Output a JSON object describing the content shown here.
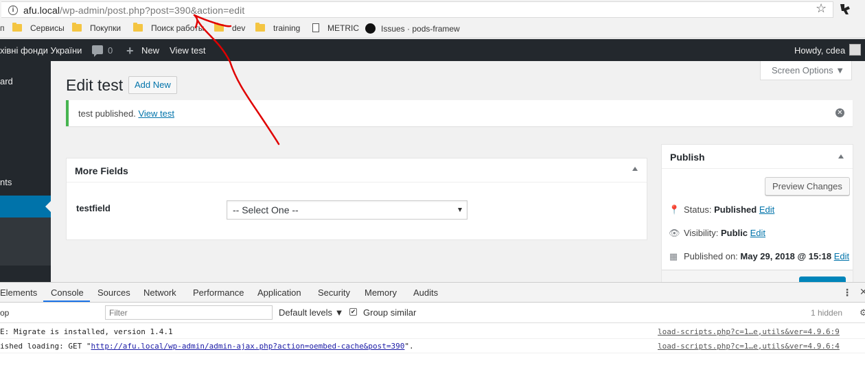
{
  "browser": {
    "url_host": "afu.local",
    "url_path": "/wp-admin/post.php?post=390&action=edit"
  },
  "bookmarks": [
    {
      "label": "Сервисы",
      "icon": "folder-icon"
    },
    {
      "label": "Покупки",
      "icon": "folder-icon"
    },
    {
      "label": "Поиск работы",
      "icon": "folder-icon"
    },
    {
      "label": "dev",
      "icon": "folder-icon"
    },
    {
      "label": "training",
      "icon": "folder-icon"
    },
    {
      "label": "METRIC",
      "icon": "page-icon"
    },
    {
      "label": "Issues · pods-framew",
      "icon": "github-icon"
    }
  ],
  "adminbar": {
    "site_name": "хівні фонди України",
    "comments_count": "0",
    "new_label": "New",
    "view_label": "View test",
    "howdy": "Howdy, cdea"
  },
  "sidebar": {
    "item_dashboard": "ard",
    "item_comments": "nts"
  },
  "header": {
    "screen_options": "Screen Options",
    "title": "Edit test",
    "add_new": "Add New"
  },
  "notice": {
    "text": "test published.",
    "link": "View test"
  },
  "more_fields": {
    "title": "More Fields",
    "field_label": "testfield",
    "select_value": "-- Select One --"
  },
  "publish": {
    "title": "Publish",
    "preview_button": "Preview Changes",
    "status_label": "Status:",
    "status_value": "Published",
    "visibility_label": "Visibility:",
    "visibility_value": "Public",
    "published_label": "Published on:",
    "published_value": "May 29, 2018 @ 15:18",
    "edit_link": "Edit"
  },
  "devtools": {
    "tabs": [
      "Elements",
      "Console",
      "Sources",
      "Network",
      "Performance",
      "Application",
      "Security",
      "Memory",
      "Audits"
    ],
    "active_tab": "Console",
    "context": "op",
    "filter_placeholder": "Filter",
    "levels": "Default levels",
    "group_similar": "Group similar",
    "hidden": "1 hidden",
    "logs": [
      {
        "message": "E: Migrate is installed, version 1.4.1",
        "source": "load-scripts.php?c=1…e,utils&ver=4.9.6:9"
      },
      {
        "message_before": "ished loading: GET \"",
        "url": "http://afu.local/wp-admin/admin-ajax.php?action=oembed-cache&post=390",
        "message_after": "\".",
        "source": "load-scripts.php?c=1…e,utils&ver=4.9.6:4"
      }
    ]
  },
  "colors": {
    "admin_bar": "#23282d",
    "accent": "#0073aa",
    "notice_success": "#46b450",
    "annotation": "#e00000"
  }
}
